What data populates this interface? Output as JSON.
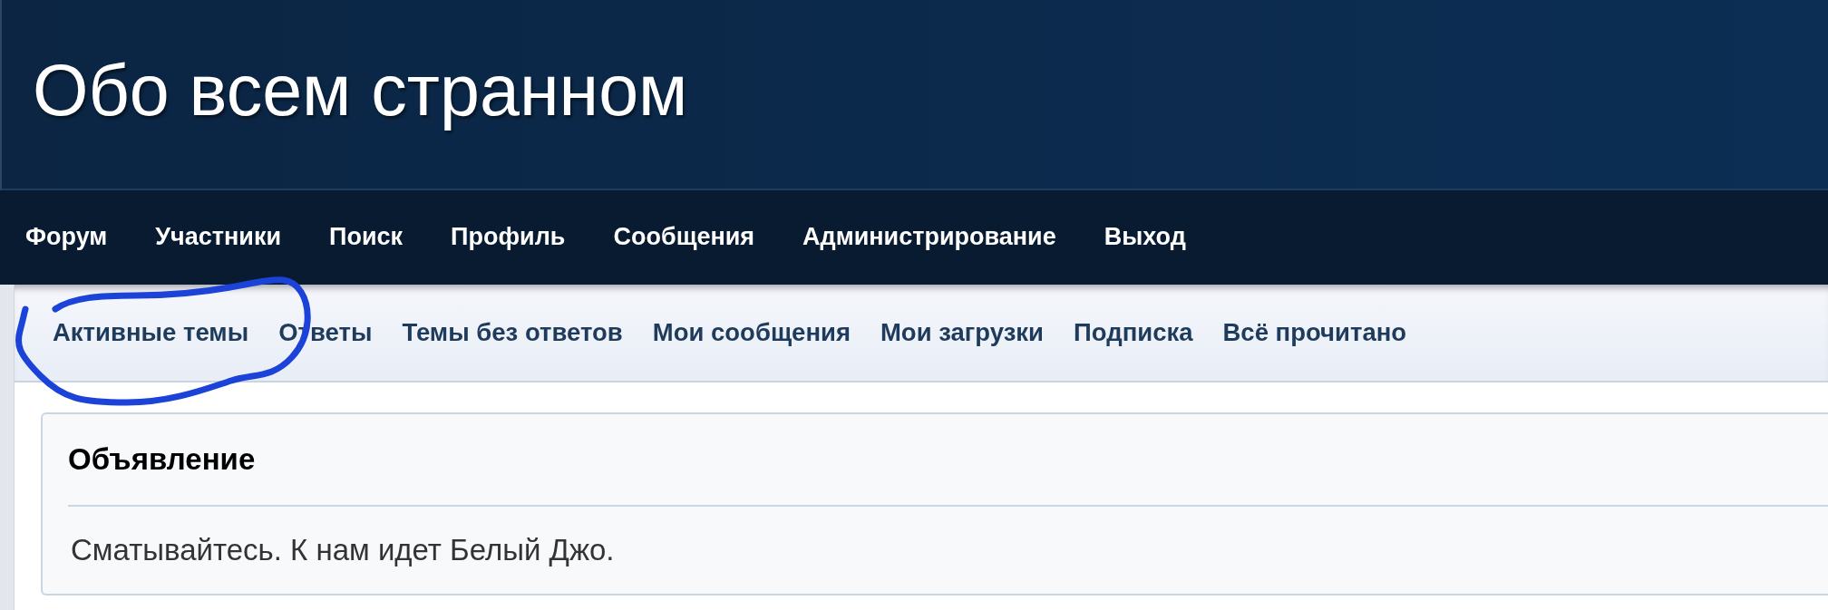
{
  "site_title": "Обо всем странном",
  "main_nav": [
    {
      "label": "Форум"
    },
    {
      "label": "Участники"
    },
    {
      "label": "Поиск"
    },
    {
      "label": "Профиль"
    },
    {
      "label": "Сообщения"
    },
    {
      "label": "Администрирование"
    },
    {
      "label": "Выход"
    }
  ],
  "sub_nav": [
    {
      "label": "Активные темы"
    },
    {
      "label": "Ответы"
    },
    {
      "label": "Темы без ответов"
    },
    {
      "label": "Мои сообщения"
    },
    {
      "label": "Мои загрузки"
    },
    {
      "label": "Подписка"
    },
    {
      "label": "Всё прочитано"
    }
  ],
  "announcement": {
    "title": "Объявление",
    "text": "Сматывайтесь. К нам идет Белый Джо."
  }
}
